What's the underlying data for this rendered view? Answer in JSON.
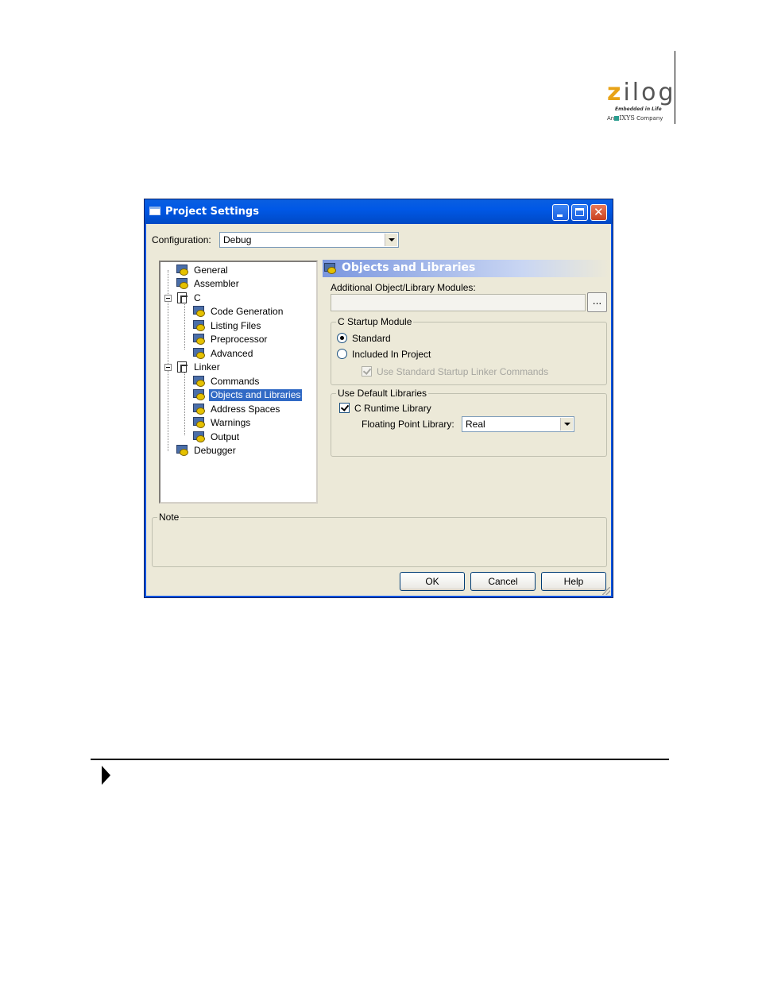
{
  "logo": {
    "word": "zilog",
    "tagline": "Embedded in Life",
    "company_prefix": "An",
    "company_name": "IXYS",
    "company_suffix": "Company"
  },
  "window": {
    "title": "Project Settings",
    "controls": {
      "minimize": "minimize",
      "maximize": "maximize",
      "close": "✕"
    }
  },
  "configuration": {
    "label": "Configuration:",
    "value": "Debug"
  },
  "tree": {
    "items": [
      {
        "label": "General",
        "icon": "gear-doc-icon"
      },
      {
        "label": "Assembler",
        "icon": "gear-doc-icon"
      },
      {
        "label": "C",
        "icon": "folder-doc-icon"
      },
      {
        "label": "Code Generation",
        "icon": "gear-doc-icon"
      },
      {
        "label": "Listing Files",
        "icon": "gear-doc-icon"
      },
      {
        "label": "Preprocessor",
        "icon": "gear-doc-icon"
      },
      {
        "label": "Advanced",
        "icon": "gear-doc-icon"
      },
      {
        "label": "Linker",
        "icon": "folder-doc-icon"
      },
      {
        "label": "Commands",
        "icon": "gear-doc-icon"
      },
      {
        "label": "Objects and Libraries",
        "icon": "gear-doc-icon"
      },
      {
        "label": "Address Spaces",
        "icon": "gear-doc-icon"
      },
      {
        "label": "Warnings",
        "icon": "gear-doc-icon"
      },
      {
        "label": "Output",
        "icon": "gear-doc-icon"
      },
      {
        "label": "Debugger",
        "icon": "gear-doc-icon"
      }
    ],
    "selected": "Objects and Libraries"
  },
  "panel": {
    "title": "Objects and Libraries",
    "additional_label": "Additional Object/Library Modules:",
    "additional_value": "",
    "browse_label": "...",
    "startup": {
      "title": "C Startup Module",
      "standard": "Standard",
      "included": "Included In Project",
      "use_standard_linker": "Use Standard Startup Linker Commands"
    },
    "default_libs": {
      "title": "Use Default Libraries",
      "c_runtime": "C Runtime Library",
      "fp_label": "Floating Point Library:",
      "fp_value": "Real"
    }
  },
  "note": {
    "title": "Note",
    "text": ""
  },
  "buttons": {
    "ok": "OK",
    "cancel": "Cancel",
    "help": "Help"
  },
  "colors": {
    "title_bar": "#0058e6",
    "selection": "#316ac5",
    "dialog_bg": "#ece9d8",
    "logo_accent": "#e8a317"
  }
}
